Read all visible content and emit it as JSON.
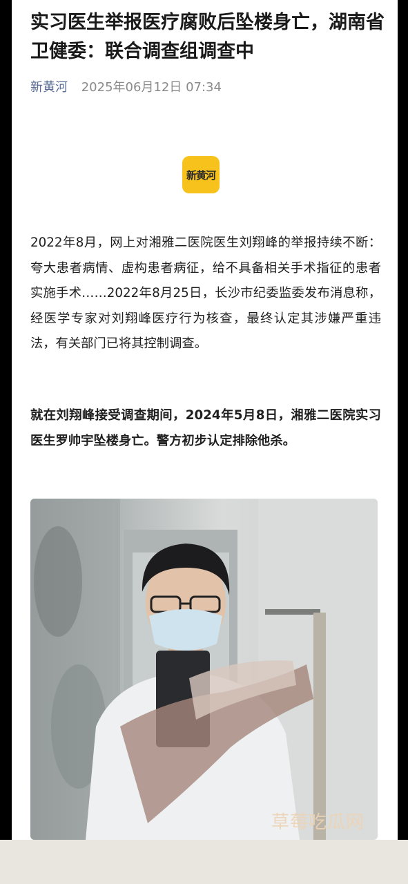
{
  "article": {
    "title": "实习医生举报医疗腐败后坠楼身亡，湖南省卫健委：联合调查组调查中",
    "source": "新黄河",
    "date": "2025年06月12日 07:34",
    "logo_text": "新黄河",
    "paragraphs": [
      "2022年8月，网上对湘雅二医院医生刘翔峰的举报持续不断：夸大患者病情、虚构患者病征，给不具备相关手术指征的患者实施手术……2022年8月25日，长沙市纪委监委发布消息称，经医学专家对刘翔峰医疗行为核查，最终认定其涉嫌严重违法，有关部门已将其控制调查。",
      "就在刘翔峰接受调查期间，2024年5月8日，湘雅二医院实习医生罗帅宇坠楼身亡。警方初步认定排除他杀。"
    ]
  },
  "watermark": "草莓吃瓜网",
  "colors": {
    "source_link": "#576b95",
    "logo_bg": "#f7c21b",
    "meta_gray": "#8a8a8a"
  }
}
